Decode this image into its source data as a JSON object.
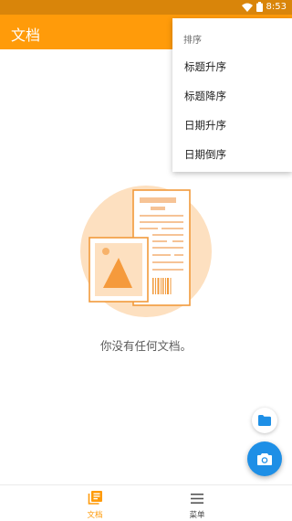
{
  "status_bar": {
    "time": "8:53"
  },
  "app_bar": {
    "title": "文档"
  },
  "sort_menu": {
    "header": "排序",
    "items": [
      {
        "label": "标题升序"
      },
      {
        "label": "标题降序"
      },
      {
        "label": "日期升序"
      },
      {
        "label": "日期倒序"
      }
    ]
  },
  "empty_state": {
    "message": "你没有任何文档。"
  },
  "bottom_nav": {
    "items": [
      {
        "label": "文档",
        "icon": "documents-icon",
        "active": true
      },
      {
        "label": "菜单",
        "icon": "menu-icon",
        "active": false
      }
    ]
  },
  "colors": {
    "app_bar": "#ff9b0a",
    "status_bar": "#d9850a",
    "accent_blue": "#1e8fe6",
    "illustration_circle": "#fde0c0"
  }
}
